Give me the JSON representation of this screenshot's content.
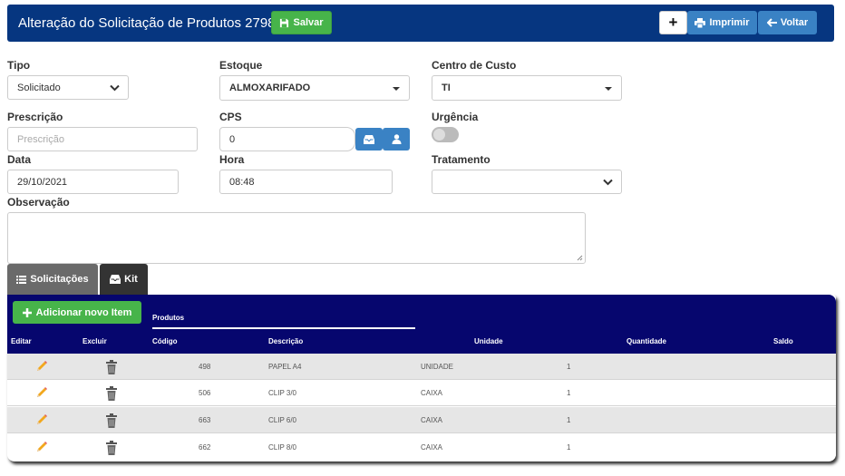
{
  "header": {
    "title": "Alteração do Solicitação de Produtos 2798",
    "save_label": "Salvar",
    "plus_label": "+",
    "print_label": "Imprimir",
    "back_label": "Voltar"
  },
  "form": {
    "tipo": {
      "label": "Tipo",
      "value": "Solicitado"
    },
    "estoque": {
      "label": "Estoque",
      "value": "ALMOXARIFADO"
    },
    "centro_custo": {
      "label": "Centro de Custo",
      "value": "TI"
    },
    "prescricao": {
      "label": "Prescrição",
      "placeholder": "Prescrição"
    },
    "cps": {
      "label": "CPS",
      "value": "0"
    },
    "urgencia": {
      "label": "Urgência",
      "on": false
    },
    "data": {
      "label": "Data",
      "value": "29/10/2021"
    },
    "hora": {
      "label": "Hora",
      "value": "08:48"
    },
    "tratamento": {
      "label": "Tratamento",
      "value": ""
    },
    "observacao": {
      "label": "Observação",
      "value": ""
    }
  },
  "tabs": [
    {
      "label": "Solicitações",
      "icon": "list-icon",
      "active": true
    },
    {
      "label": "Kit",
      "icon": "inbox-icon",
      "active": false
    }
  ],
  "table": {
    "add_label": "Adicionar novo Item",
    "section_title": "Produtos",
    "columns": [
      "Editar",
      "Excluir",
      "Código",
      "Descrição",
      "Unidade",
      "Quantidade",
      "Saldo"
    ],
    "rows": [
      {
        "codigo": "498",
        "descricao": "PAPEL A4",
        "unidade": "UNIDADE",
        "quantidade": "1",
        "saldo": ""
      },
      {
        "codigo": "506",
        "descricao": "CLIP 3/0",
        "unidade": "CAIXA",
        "quantidade": "1",
        "saldo": ""
      },
      {
        "codigo": "663",
        "descricao": "CLIP 6/0",
        "unidade": "CAIXA",
        "quantidade": "1",
        "saldo": ""
      },
      {
        "codigo": "662",
        "descricao": "CLIP 8/0",
        "unidade": "CAIXA",
        "quantidade": "1",
        "saldo": ""
      }
    ]
  },
  "colors": {
    "header_bg": "#063680",
    "success": "#47b44a",
    "primary": "#3a82c4",
    "table_head": "#06066e"
  }
}
